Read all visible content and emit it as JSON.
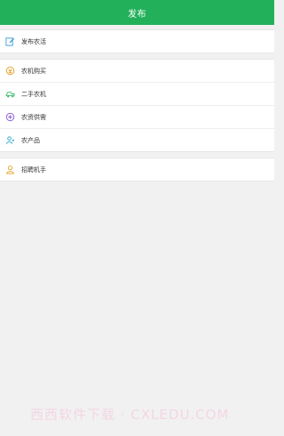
{
  "header": {
    "title": "发布"
  },
  "groups": [
    [
      {
        "label": "发布农活",
        "icon": "edit-icon",
        "color": "#3d9ad8"
      }
    ],
    [
      {
        "label": "农机购买",
        "icon": "coin-icon",
        "color": "#e0a12a"
      },
      {
        "label": "二手农机",
        "icon": "truck-icon",
        "color": "#3dba6a"
      },
      {
        "label": "农资供需",
        "icon": "gift-icon",
        "color": "#8b5ad6"
      },
      {
        "label": "农产品",
        "icon": "leaf-icon",
        "color": "#2da7c9"
      }
    ],
    [
      {
        "label": "招聘机手",
        "icon": "person-icon",
        "color": "#e0a12a"
      }
    ]
  ],
  "watermark": "西西软件下载 · CXLEDU.COM"
}
